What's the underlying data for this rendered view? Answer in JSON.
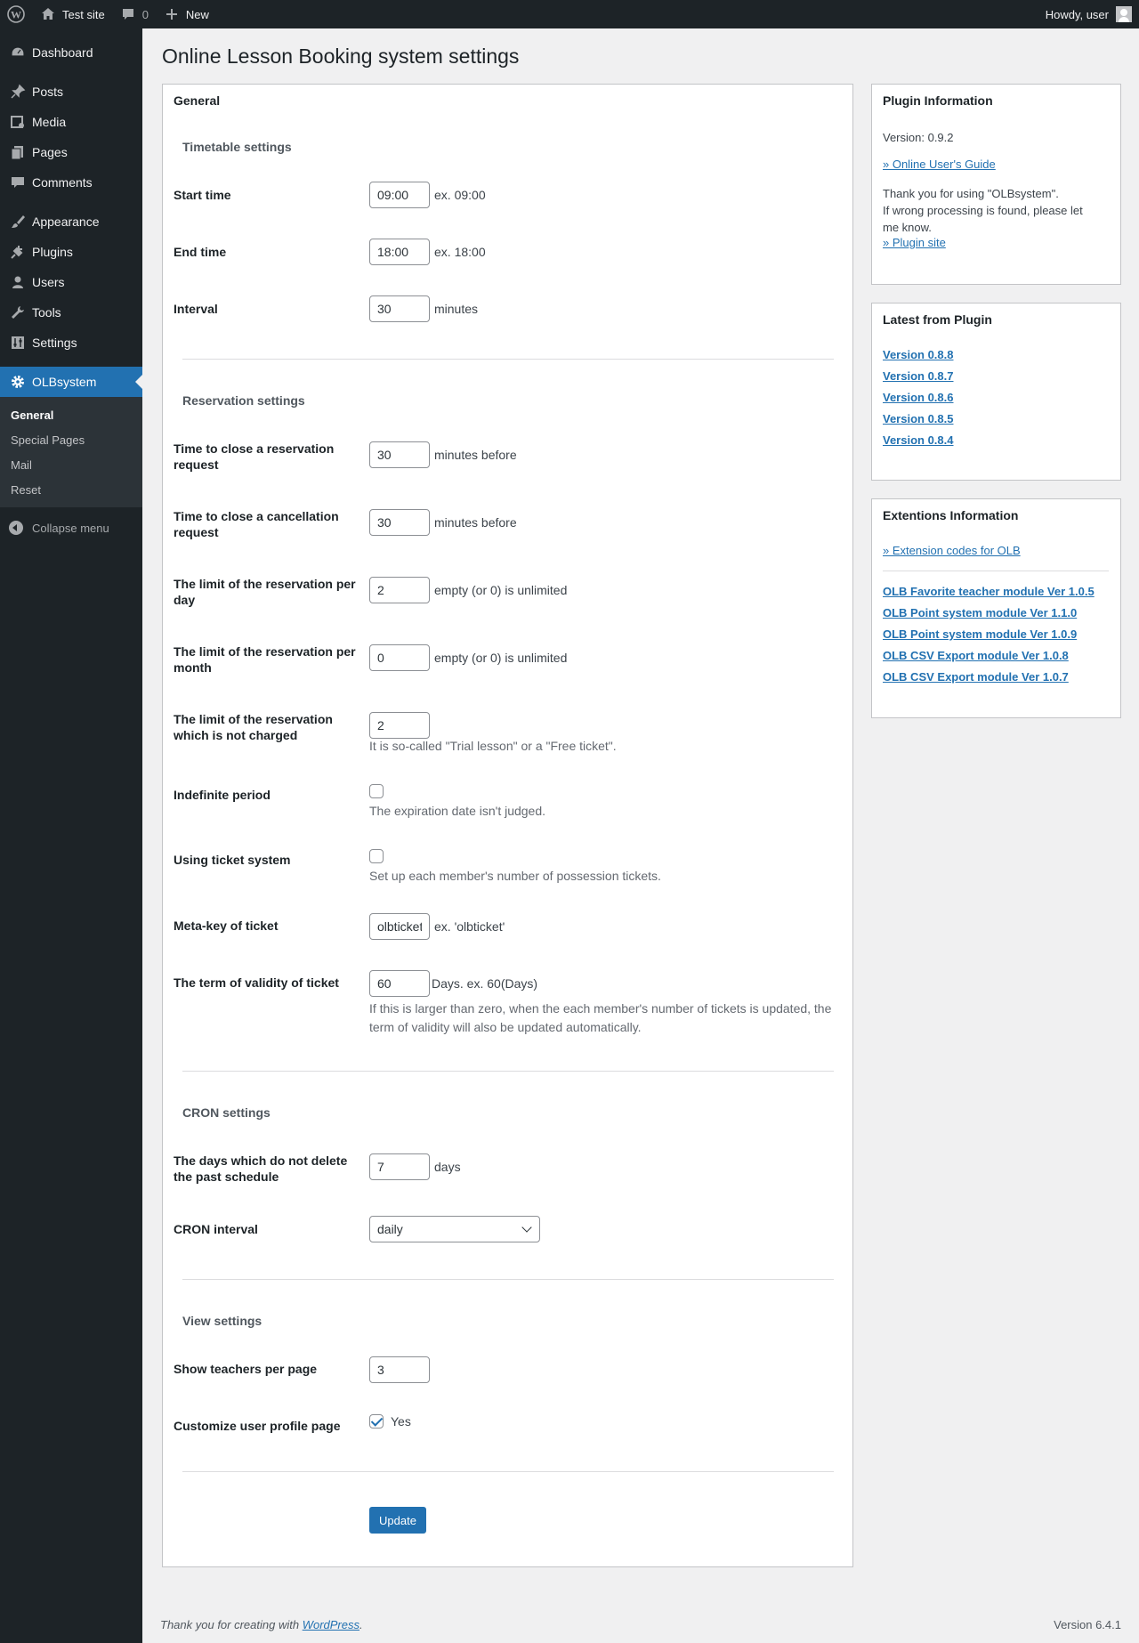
{
  "adminbar": {
    "site_name": "Test site",
    "comments_count": "0",
    "new_label": "New",
    "howdy": "Howdy, user"
  },
  "sidebar": {
    "items": [
      {
        "label": "Dashboard",
        "icon": "dashboard-icon"
      },
      {
        "label": "Posts",
        "icon": "pin-icon"
      },
      {
        "label": "Media",
        "icon": "media-icon"
      },
      {
        "label": "Pages",
        "icon": "pages-icon"
      },
      {
        "label": "Comments",
        "icon": "comment-icon"
      },
      {
        "label": "Appearance",
        "icon": "brush-icon"
      },
      {
        "label": "Plugins",
        "icon": "plug-icon"
      },
      {
        "label": "Users",
        "icon": "user-icon"
      },
      {
        "label": "Tools",
        "icon": "wrench-icon"
      },
      {
        "label": "Settings",
        "icon": "sliders-icon"
      },
      {
        "label": "OLBsystem",
        "icon": "gear-icon"
      }
    ],
    "submenu": [
      "General",
      "Special Pages",
      "Mail",
      "Reset"
    ],
    "collapse": "Collapse menu"
  },
  "page": {
    "title": "Online Lesson Booking system settings",
    "box_title": "General"
  },
  "timetable": {
    "heading": "Timetable settings",
    "start_label": "Start time",
    "start_value": "09:00",
    "start_hint": "ex. 09:00",
    "end_label": "End time",
    "end_value": "18:00",
    "end_hint": "ex. 18:00",
    "interval_label": "Interval",
    "interval_value": "30",
    "interval_unit": "minutes"
  },
  "reservation": {
    "heading": "Reservation settings",
    "close_res_label": "Time to close a reservation request",
    "close_res_value": "30",
    "close_res_unit": "minutes before",
    "close_cancel_label": "Time to close a cancellation request",
    "close_cancel_value": "30",
    "close_cancel_unit": "minutes before",
    "limit_day_label": "The limit of the reservation per day",
    "limit_day_value": "2",
    "limit_day_unit": "empty (or 0) is unlimited",
    "limit_month_label": "The limit of the reservation per month",
    "limit_month_value": "0",
    "limit_month_unit": "empty (or 0) is unlimited",
    "limit_free_label": "The limit of the reservation which is not charged",
    "limit_free_value": "2",
    "limit_free_desc": "It is so-called \"Trial lesson\" or a \"Free ticket\".",
    "indefinite_label": "Indefinite period",
    "indefinite_desc": "The expiration date isn't judged.",
    "ticket_label": "Using ticket system",
    "ticket_desc": "Set up each member's number of possession tickets.",
    "metakey_label": "Meta-key of ticket",
    "metakey_value": "olbticket",
    "metakey_hint": "ex. 'olbticket'",
    "validity_label": "The term of validity of ticket",
    "validity_value": "60",
    "validity_unit": "Days. ex. 60(Days)",
    "validity_desc": "If this is larger than zero, when the each member's number of tickets is updated, the term of validity will also be updated automatically."
  },
  "cron": {
    "heading": "CRON settings",
    "days_label": "The days which do not delete the past schedule",
    "days_value": "7",
    "days_unit": "days",
    "interval_label": "CRON interval",
    "interval_value": "daily"
  },
  "view": {
    "heading": "View settings",
    "teachers_label": "Show teachers per page",
    "teachers_value": "3",
    "profile_label": "Customize user profile page",
    "profile_option": "Yes"
  },
  "update_button": "Update",
  "plugin_info": {
    "title": "Plugin Information",
    "version": "Version: 0.9.2",
    "guide_link": "» Online User's Guide",
    "thanks": "Thank you for using \"OLBsystem\".",
    "report": "If wrong processing is found, please let me know.",
    "site_link": "» Plugin site"
  },
  "latest": {
    "title": "Latest from Plugin",
    "items": [
      "Version 0.8.8",
      "Version 0.8.7",
      "Version 0.8.6",
      "Version 0.8.5",
      "Version 0.8.4"
    ]
  },
  "extensions": {
    "title": "Extentions Information",
    "codes_link": "» Extension codes for OLB",
    "items": [
      "OLB Favorite teacher module Ver 1.0.5",
      "OLB Point system module Ver 1.1.0",
      "OLB Point system module Ver 1.0.9",
      "OLB CSV Export module Ver 1.0.8",
      "OLB CSV Export module Ver 1.0.7"
    ]
  },
  "footer": {
    "thanks_prefix": "Thank you for creating with ",
    "wp_link": "WordPress",
    "suffix": ".",
    "version": "Version 6.4.1"
  }
}
